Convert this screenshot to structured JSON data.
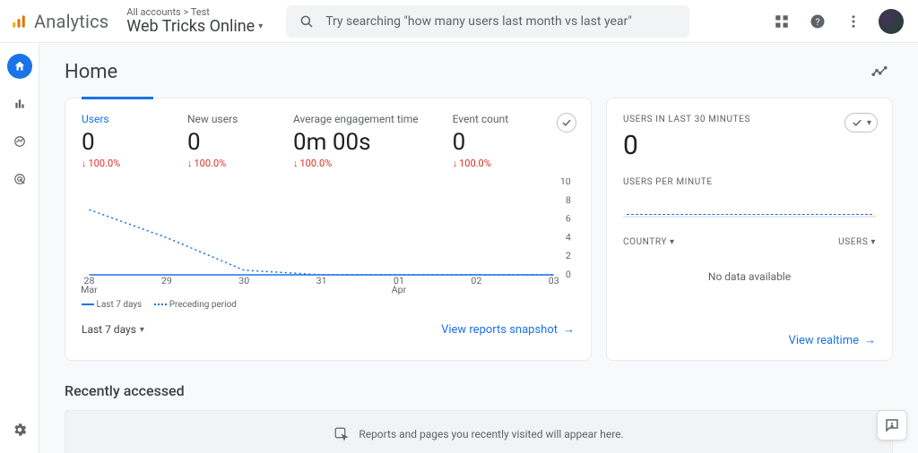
{
  "brand": "Analytics",
  "breadcrumb": "All accounts > Test",
  "property": "Web Tricks Online",
  "search_placeholder": "Try searching \"how many users last month vs last year\"",
  "page_title": "Home",
  "metrics": {
    "users": {
      "label": "Users",
      "value": "0",
      "delta": "100.0%"
    },
    "new_users": {
      "label": "New users",
      "value": "0",
      "delta": "100.0%"
    },
    "engagement": {
      "label": "Average engagement time",
      "value": "0m 00s",
      "delta": "100.0%"
    },
    "event_count": {
      "label": "Event count",
      "value": "0",
      "delta": "100.0%"
    }
  },
  "chart_data": {
    "type": "line",
    "x_dates": [
      "28 Mar",
      "29",
      "30",
      "31",
      "01 Apr",
      "02",
      "03"
    ],
    "y_ticks": [
      0,
      2,
      4,
      6,
      8,
      10
    ],
    "series": [
      {
        "name": "Last 7 days",
        "style": "solid",
        "values": [
          0,
          0,
          0,
          0,
          0,
          0,
          0
        ]
      },
      {
        "name": "Preceding period",
        "style": "dashed",
        "values": [
          7,
          4,
          0.5,
          0,
          0,
          0,
          0
        ]
      }
    ],
    "ylim": [
      0,
      10
    ]
  },
  "legend": {
    "last": "Last 7 days",
    "prev": "Preceding period"
  },
  "main_card": {
    "date_range": "Last 7 days",
    "cta": "View reports snapshot"
  },
  "realtime": {
    "header": "USERS IN LAST 30 MINUTES",
    "big": "0",
    "sub": "USERS PER MINUTE",
    "col_country": "COUNTRY",
    "col_users": "USERS",
    "nodata": "No data available",
    "cta": "View realtime"
  },
  "recent": {
    "title": "Recently accessed",
    "empty": "Reports and pages you recently visited will appear here."
  }
}
